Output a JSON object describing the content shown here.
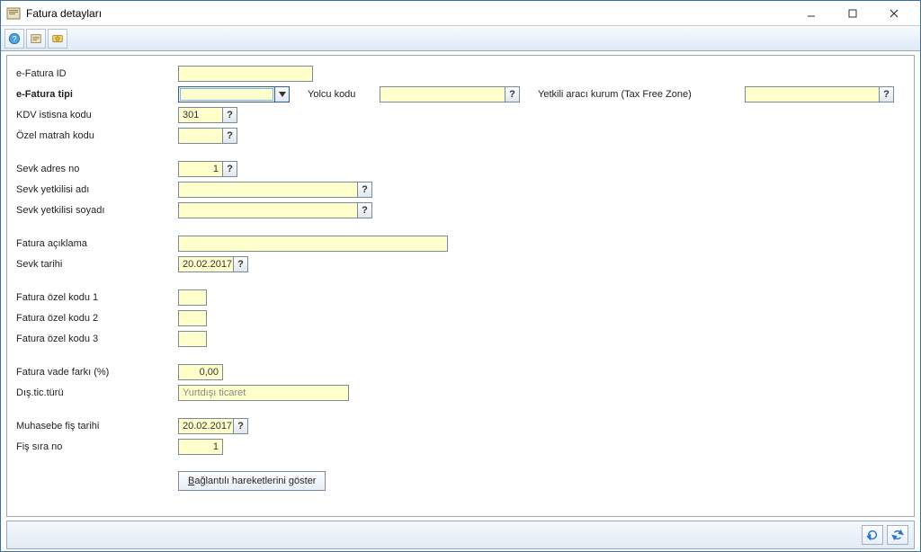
{
  "window": {
    "title": "Fatura detayları"
  },
  "labels": {
    "efatura_id": "e-Fatura ID",
    "efatura_tipi": "e-Fatura tipi",
    "yolcu_kodu": "Yolcu kodu",
    "yetkili_araci": "Yetkili aracı kurum (Tax Free Zone)",
    "kdv_istisna": "KDV istisna kodu",
    "ozel_matrah": "Özel matrah kodu",
    "sevk_adres_no": "Sevk adres no",
    "sevk_yetkilisi_adi": "Sevk yetkilisi adı",
    "sevk_yetkilisi_soyadi": "Sevk yetkilisi soyadı",
    "fatura_aciklama": "Fatura açıklama",
    "sevk_tarihi": "Sevk tarihi",
    "fatura_ozel_1": "Fatura özel kodu 1",
    "fatura_ozel_2": "Fatura özel kodu 2",
    "fatura_ozel_3": "Fatura özel kodu 3",
    "fatura_vade_farki": "Fatura vade farkı (%)",
    "dis_tic_turu": "Dış.tic.türü",
    "muhasebe_fis_tarihi": "Muhasebe fiş tarihi",
    "fis_sira_no": "Fiş sıra no"
  },
  "values": {
    "efatura_id": "",
    "efatura_tipi": "",
    "yolcu_kodu": "",
    "yetkili_araci": "",
    "kdv_istisna": "301",
    "ozel_matrah": "",
    "sevk_adres_no": "1",
    "sevk_yetkilisi_adi": "",
    "sevk_yetkilisi_soyadi": "",
    "fatura_aciklama": "",
    "sevk_tarihi": "20.02.2017",
    "fatura_ozel_1": "",
    "fatura_ozel_2": "",
    "fatura_ozel_3": "",
    "fatura_vade_farki": "0,00",
    "dis_tic_turu": "Yurtdışı ticaret",
    "muhasebe_fis_tarihi": "20.02.2017",
    "fis_sira_no": "1"
  },
  "buttons": {
    "baglantili": "Bağlantılı hareketlerini göster",
    "baglantili_accel": "B"
  }
}
